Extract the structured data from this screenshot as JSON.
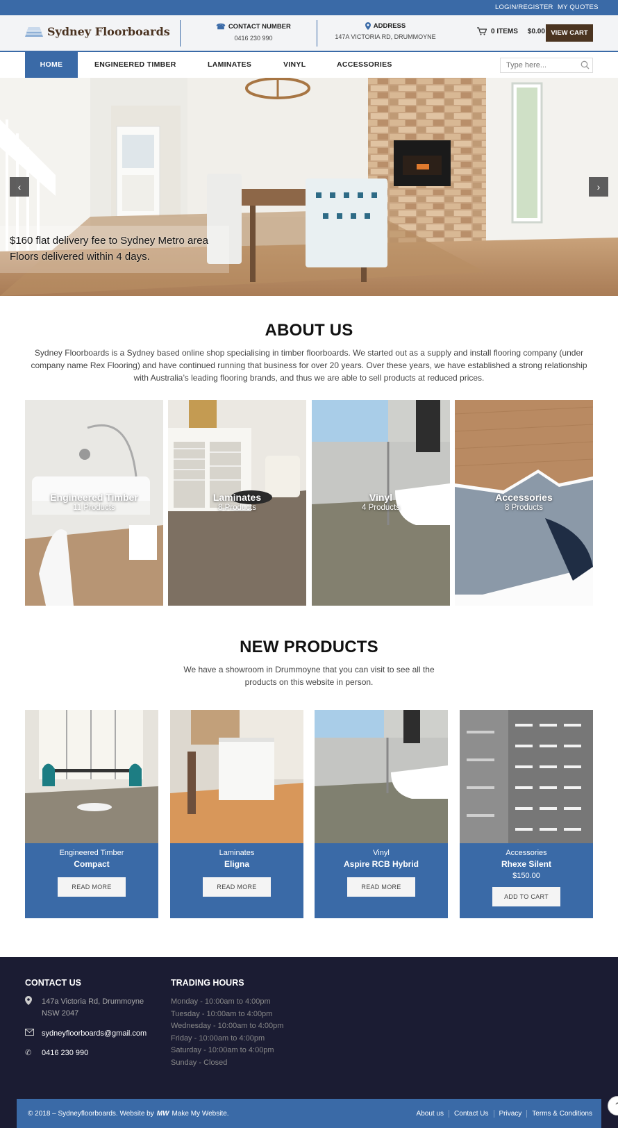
{
  "topbar": {
    "login": "LOGIN/REGISTER",
    "quotes": "MY QUOTES"
  },
  "header": {
    "logo": "Sydney Floorboards",
    "contact_title": "CONTACT NUMBER",
    "contact_value": "0416 230 990",
    "address_title": "ADDRESS",
    "address_value": "147A VICTORIA RD, DRUMMOYNE",
    "cart_items": "0 ITEMS",
    "cart_total": "$0.00",
    "view_cart": "VIEW CART"
  },
  "nav": {
    "items": [
      "HOME",
      "ENGINEERED TIMBER",
      "LAMINATES",
      "VINYL",
      "ACCESSORIES"
    ],
    "search_placeholder": "Type here..."
  },
  "hero": {
    "line1": "$160 flat delivery fee to Sydney Metro area",
    "line2": "Floors delivered within 4 days."
  },
  "about": {
    "title": "ABOUT US",
    "text": "Sydney Floorboards is a Sydney based online shop specialising in timber floorboards. We started out as a supply and install flooring company (under company name Rex Flooring) and have continued running that business for over 20 years. Over these years, we have established a strong relationship with Australia’s leading flooring brands, and thus we are able to sell products at reduced prices."
  },
  "categories": [
    {
      "name": "Engineered Timber",
      "count": "11 Products"
    },
    {
      "name": "Laminates",
      "count": "8 Products"
    },
    {
      "name": "Vinyl",
      "count": "4 Products"
    },
    {
      "name": "Accessories",
      "count": "8 Products"
    }
  ],
  "new_products": {
    "title": "NEW PRODUCTS",
    "text": "We have a showroom in Drummoyne that you can visit to see all the products on this website in person.",
    "items": [
      {
        "category": "Engineered Timber",
        "name": "Compact",
        "button": "READ MORE"
      },
      {
        "category": "Laminates",
        "name": "Eligna",
        "button": "READ MORE"
      },
      {
        "category": "Vinyl",
        "name": "Aspire RCB Hybrid",
        "button": "READ MORE"
      },
      {
        "category": "Accessories",
        "name": "Rhexe Silent",
        "price": "$150.00",
        "button": "ADD TO CART"
      }
    ]
  },
  "footer": {
    "contact_title": "CONTACT US",
    "address": "147a Victoria Rd, Drummoyne NSW 2047",
    "email": "sydneyfloorboards@gmail.com",
    "phone": "0416 230 990",
    "hours_title": "TRADING HOURS",
    "hours": [
      "Monday - 10:00am to 4:00pm",
      "Tuesday - 10:00am to 4:00pm",
      "Wednesday - 10:00am to 4:00pm",
      "Friday - 10:00am to 4:00pm",
      "Saturday - 10:00am to 4:00pm",
      "Sunday - Closed"
    ],
    "copyright": "© 2018 – Sydneyfloorboards. Website by",
    "brand": "Make My Website.",
    "links": [
      "About us",
      "Contact Us",
      "Privacy",
      "Terms & Conditions"
    ]
  }
}
